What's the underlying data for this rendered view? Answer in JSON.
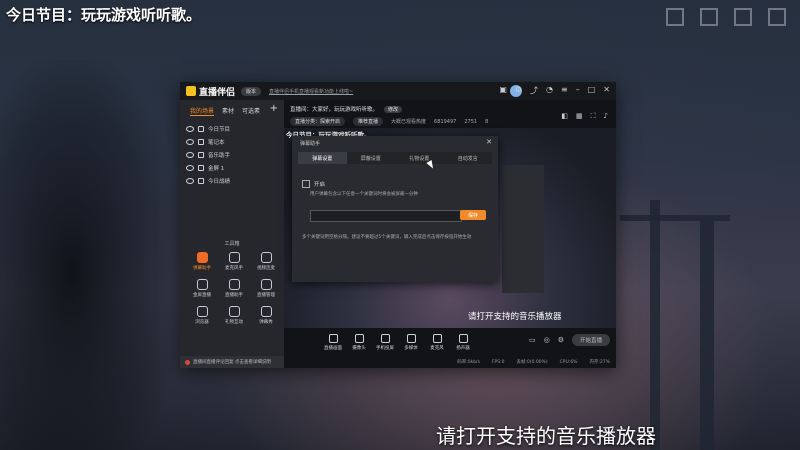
{
  "overlay": {
    "top_title": "今日节目：玩玩游戏听听歌。",
    "bottom_subtitle": "请打开支持的音乐播放器"
  },
  "app": {
    "name": "直播伴侣",
    "version_badge": "版本",
    "notice": "直播伴侣手机直播观看新功能上线啦~",
    "titlebar_icons": [
      "skin-icon",
      "gift-icon",
      "settings-icon",
      "mail-icon",
      "menu-icon",
      "minimize-icon",
      "maximize-icon",
      "close-icon"
    ]
  },
  "sidebar": {
    "tabs": [
      "我的场景",
      "素材",
      "可选素"
    ],
    "active_tab": 0,
    "add_label": "+",
    "scenes": [
      {
        "label": "今日节目"
      },
      {
        "label": "笔记本"
      },
      {
        "label": "音乐助手"
      },
      {
        "label": "金屏 1"
      },
      {
        "label": "今日战绩"
      }
    ],
    "tools_title": "工具箱",
    "tools": [
      {
        "label": "弹幕助手",
        "icon": "danmaku-icon",
        "active": true
      },
      {
        "label": "麦克风手",
        "icon": "microphone-icon",
        "active": false
      },
      {
        "label": "视频连麦",
        "icon": "video-link-icon",
        "active": false
      },
      {
        "label": "金屏直播",
        "icon": "gold-screen-icon",
        "active": false
      },
      {
        "label": "直播助手",
        "icon": "live-assistant-icon",
        "active": false
      },
      {
        "label": "直播管理",
        "icon": "live-manage-icon",
        "active": false
      },
      {
        "label": "浏览器",
        "icon": "browser-icon",
        "active": false
      },
      {
        "label": "礼物互动",
        "icon": "gift-interact-icon",
        "active": false
      },
      {
        "label": "弹幕秀",
        "icon": "danmaku-show-icon",
        "active": false
      }
    ],
    "promo": "直播间直播评论回复  点击查看详细说明"
  },
  "main": {
    "room_line": "直播间：大家好，玩玩游戏听听歌。",
    "room_badge": "修改",
    "meta_pill_1": "直播分类：探索开启",
    "meta_pill_2": "推荐直播",
    "meta_viewers": "大概已观看热度",
    "meta_count_1": "6819497",
    "meta_count_2": "2751",
    "meta_count_3": "8",
    "preview_title": "今日节目：玩玩游戏听听歌。",
    "preview_subtitle": "请打开支持的音乐播放器",
    "bottom_buttons": [
      "直播画面",
      "摄像头",
      "手机投屏",
      "多媒体",
      "麦克风",
      "扬声器"
    ],
    "start_live": "开始直播",
    "status": [
      "码率:0kb/s",
      "FPS:0",
      "丢帧:0(0.00%)",
      "CPU:6%",
      "内存:27%"
    ]
  },
  "dialog": {
    "title": "弹幕助手",
    "close": "✕",
    "tabs": [
      "弹幕设置",
      "屏蔽设置",
      "礼物设置",
      "自动发言"
    ],
    "active_tab": 0,
    "checkbox_label": "开启",
    "description": "用户弹幕包含以下任意一个关键词时将会被屏蔽一分钟",
    "input_placeholder": "",
    "save_button": "保存",
    "note": "多个关键词用空格分隔。建议不要超过5个关键词，输入完成后点击保存按钮开始生效"
  }
}
